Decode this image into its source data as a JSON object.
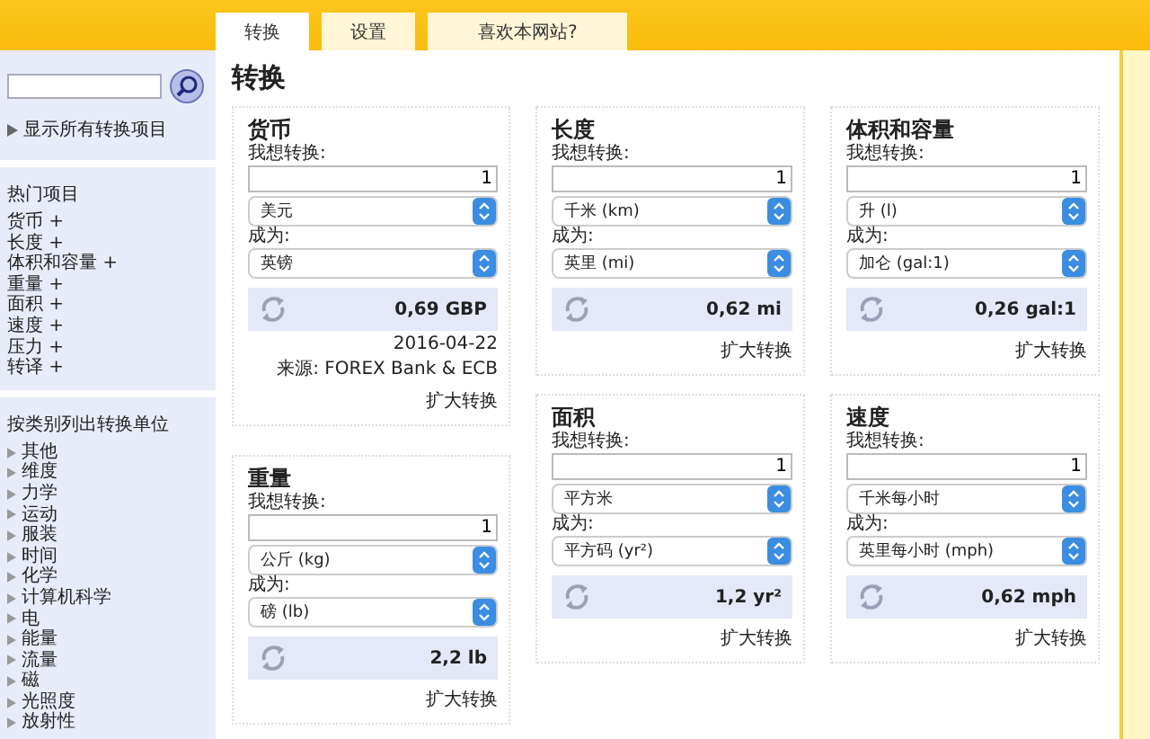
{
  "tabs": [
    {
      "label": "转换",
      "selected": true
    },
    {
      "label": "设置",
      "selected": false
    },
    {
      "label": "喜欢本网站?",
      "selected": false
    }
  ],
  "sidebar": {
    "show_all": "显示所有转换项目",
    "popular": {
      "title": "热门项目",
      "items": [
        "货币 +",
        "长度 +",
        "体积和容量 +",
        "重量 +",
        "面积 +",
        "速度 +",
        "压力 +",
        "转译 +"
      ]
    },
    "categories": {
      "title": "按类别列出转换单位",
      "items": [
        "其他",
        "维度",
        "力学",
        "运动",
        "服装",
        "时间",
        "化学",
        "计算机科学",
        "电",
        "能量",
        "流量",
        "磁",
        "光照度",
        "放射性"
      ]
    }
  },
  "page_title": "转换",
  "columns": [
    [
      {
        "title": "货币",
        "input_label": "我想转换:",
        "value": "1",
        "from_unit": "美元",
        "to_label": "成为:",
        "to_unit": "英镑",
        "result": "0,69 GBP",
        "notes": [
          "2016-04-22",
          "来源: FOREX Bank & ECB"
        ],
        "link": "扩大转换"
      },
      {
        "title": "重量",
        "input_label": "我想转换:",
        "value": "1",
        "from_unit": "公斤 (kg)",
        "to_label": "成为:",
        "to_unit": "磅 (lb)",
        "result": "2,2 lb",
        "link": "扩大转换"
      }
    ],
    [
      {
        "title": "长度",
        "input_label": "我想转换:",
        "value": "1",
        "from_unit": "千米 (km)",
        "to_label": "成为:",
        "to_unit": "英里 (mi)",
        "result": "0,62 mi",
        "link": "扩大转换"
      },
      {
        "title": "面积",
        "input_label": "我想转换:",
        "value": "1",
        "from_unit": "平方米",
        "to_label": "成为:",
        "to_unit": "平方码 (yr²)",
        "result": "1,2 yr²",
        "link": "扩大转换"
      }
    ],
    [
      {
        "title": "体积和容量",
        "input_label": "我想转换:",
        "value": "1",
        "from_unit": "升 (l)",
        "to_label": "成为:",
        "to_unit": "加仑 (gal:1)",
        "result": "0,26 gal:1",
        "link": "扩大转换"
      },
      {
        "title": "速度",
        "input_label": "我想转换:",
        "value": "1",
        "from_unit": "千米每小时",
        "to_label": "成为:",
        "to_unit": "英里每小时 (mph)",
        "result": "0,62 mph",
        "link": "扩大转换"
      }
    ]
  ]
}
